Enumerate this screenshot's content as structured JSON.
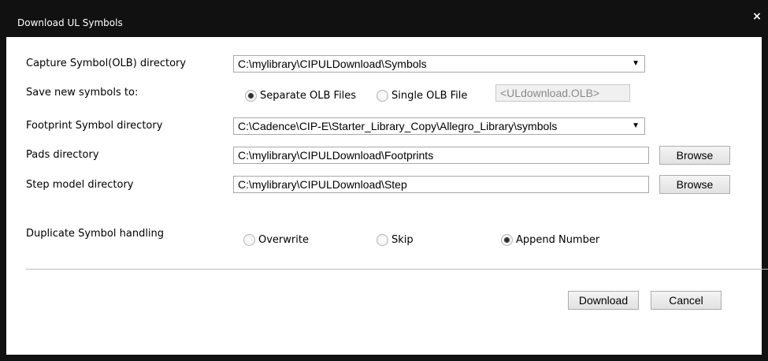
{
  "dialog": {
    "title": "Download UL Symbols",
    "close_glyph": "×"
  },
  "capture": {
    "label": "Capture Symbol(OLB) directory",
    "value": "C:\\mylibrary\\CIPULDownload\\Symbols"
  },
  "save_new": {
    "label": "Save new symbols to:",
    "separate_label": "Separate OLB Files",
    "single_label": "Single OLB File",
    "selected": "separate",
    "single_file_value": "<ULdownload.OLB>"
  },
  "footprint": {
    "label": "Footprint Symbol directory",
    "value": "C:\\Cadence\\CIP-E\\Starter_Library_Copy\\Allegro_Library\\symbols"
  },
  "pads": {
    "label": "Pads directory",
    "value": "C:\\mylibrary\\CIPULDownload\\Footprints",
    "browse_label": "Browse"
  },
  "step": {
    "label": "Step model directory",
    "value": "C:\\mylibrary\\CIPULDownload\\Step",
    "browse_label": "Browse"
  },
  "duplicate": {
    "label": "Duplicate Symbol handling",
    "overwrite_label": "Overwrite",
    "skip_label": "Skip",
    "append_label": "Append Number",
    "selected": "append"
  },
  "actions": {
    "download_label": "Download",
    "cancel_label": "Cancel"
  },
  "icons": {
    "dropdown": "chevron-down-icon",
    "close": "close-icon"
  },
  "colors": {
    "titlebar": "#111111",
    "window_bg": "#ffffff"
  }
}
